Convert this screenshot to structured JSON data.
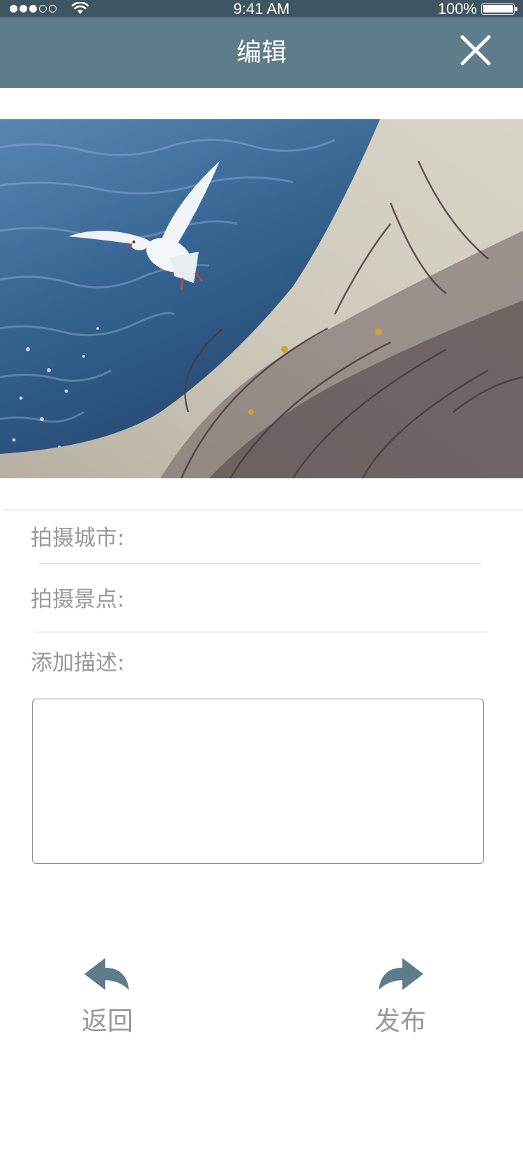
{
  "status_bar": {
    "time": "9:41 AM",
    "battery": "100%",
    "signal_icon": "signal-dots-icon",
    "wifi_icon": "wifi-icon",
    "battery_icon": "battery-icon"
  },
  "header": {
    "title": "编辑",
    "close_icon": "close-icon"
  },
  "photo": {
    "subject": "seagull-over-water-photo"
  },
  "form": {
    "city_label": "拍摄城市:",
    "city_value": "",
    "spot_label": "拍摄景点:",
    "spot_value": "",
    "description_label": "添加描述:",
    "description_value": ""
  },
  "actions": {
    "back_label": "返回",
    "back_icon": "reply-arrow-icon",
    "publish_label": "发布",
    "publish_icon": "forward-arrow-icon"
  },
  "colors": {
    "status_bar": "#3f5561",
    "header": "#5e7c89",
    "accent": "#5e7c89",
    "label_text": "#999999"
  }
}
